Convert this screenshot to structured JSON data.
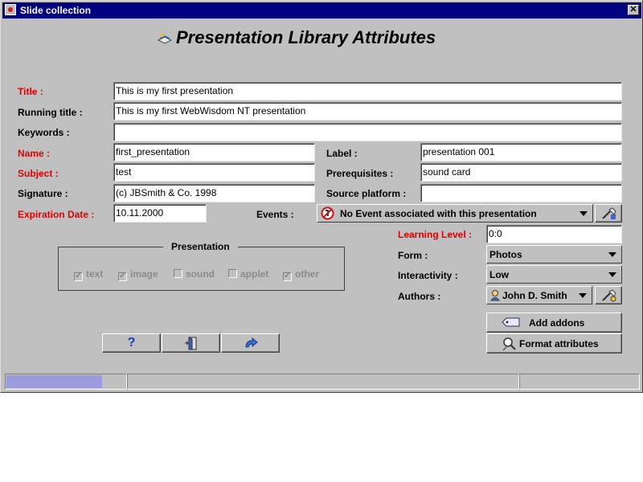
{
  "window": {
    "title": "Slide collection",
    "close_symbol": "✕"
  },
  "heading": "Presentation Library Attributes",
  "fields": {
    "title": {
      "label": "Title :",
      "value": "This is my first presentation"
    },
    "running_title": {
      "label": "Running title :",
      "value": "This is my first WebWisdom NT presentation"
    },
    "keywords": {
      "label": "Keywords :",
      "value": ""
    },
    "name": {
      "label": "Name :",
      "value": "first_presentation"
    },
    "subject": {
      "label": "Subject :",
      "value": "test"
    },
    "signature": {
      "label": "Signature :",
      "value": "(c) JBSmith & Co. 1998"
    },
    "expiration_date": {
      "label": "Expiration Date :",
      "value": "10.11.2000"
    },
    "label": {
      "label": "Label :",
      "value": "presentation 001"
    },
    "prerequisites": {
      "label": "Prerequisites :",
      "value": "sound card"
    },
    "source_platform": {
      "label": "Source platform :",
      "value": ""
    },
    "events": {
      "label": "Events :",
      "value": "No Event associated with this presentation"
    },
    "learning_level": {
      "label": "Learning Level :",
      "value": "0:0"
    },
    "form": {
      "label": "Form :",
      "value": "Photos"
    },
    "interactivity": {
      "label": "Interactivity :",
      "value": "Low"
    },
    "authors": {
      "label": "Authors :",
      "value": "John D. Smith"
    }
  },
  "presentation_group": {
    "legend": "Presentation",
    "options": [
      {
        "label": "text",
        "checked": true
      },
      {
        "label": "image",
        "checked": true
      },
      {
        "label": "sound",
        "checked": false
      },
      {
        "label": "applet",
        "checked": false
      },
      {
        "label": "other",
        "checked": true
      }
    ]
  },
  "buttons": {
    "help_symbol": "?",
    "add_addons": "Add addons",
    "format_attributes": "Format attributes"
  },
  "status": {
    "progress": 0.79
  },
  "colors": {
    "titlebar": "#000080",
    "required_label": "#e00000",
    "progress": "#9b9be0",
    "face": "#c0c0c0"
  }
}
